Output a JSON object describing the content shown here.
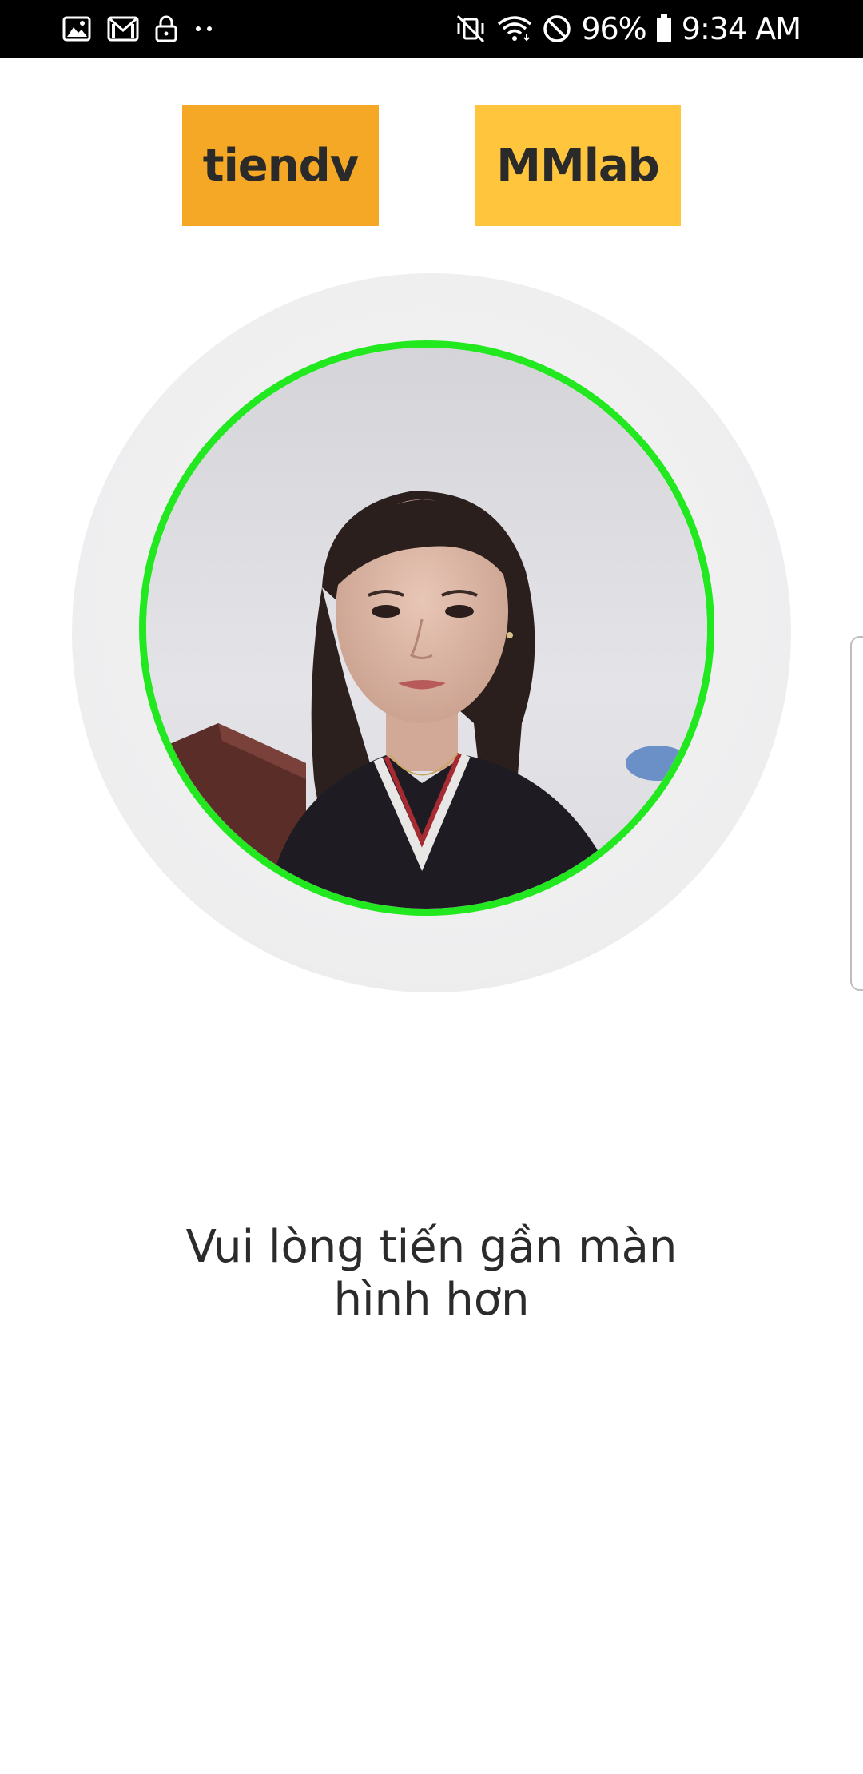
{
  "status_bar": {
    "battery": "96%",
    "time": "9:34 AM",
    "left_icons": [
      "gallery-icon",
      "gmail-icon",
      "lock-icon",
      "more-dots-icon"
    ],
    "right_icons": [
      "vibrate-off-icon",
      "wifi-icon",
      "do-not-disturb-icon",
      "battery-icon"
    ]
  },
  "header": {
    "left_label": "tiendv",
    "right_label": "MMlab",
    "left_color": "#f4a825",
    "right_color": "#ffc53d"
  },
  "scanner": {
    "ring_color": "#21e81f",
    "image": "camera-preview-face"
  },
  "instruction": {
    "line1": "Vui lòng tiến gần màn",
    "line2": "hình hơn"
  }
}
